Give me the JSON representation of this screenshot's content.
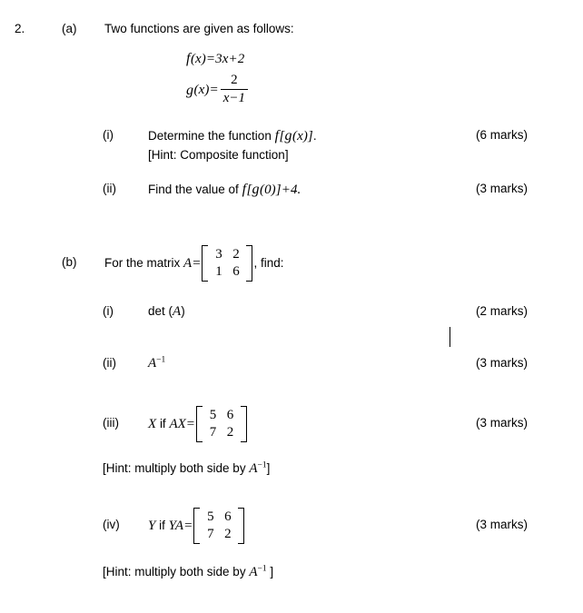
{
  "document": {
    "question_number": "2.",
    "background_color": "#ffffff",
    "text_color": "#000000"
  },
  "part_a": {
    "label": "(a)",
    "stem": "Two functions are given as follows:",
    "equations": [
      {
        "name": "f-definition",
        "fn": "f",
        "arg": "(x)",
        "eq": "=",
        "rhs_coeff": "3",
        "rhs_var": "x",
        "rhs_op": "+",
        "rhs_const": "2",
        "plain": "f(x) = 3x + 2"
      },
      {
        "name": "g-definition",
        "fn": "g",
        "arg": "(x)",
        "eq": "=",
        "numerator": "2",
        "den_var": "x",
        "den_op": "−",
        "den_const": "1",
        "plain": "g(x) = 2 / (x - 1)"
      }
    ],
    "items": [
      {
        "label": "(i)",
        "text_before": "Determine the function",
        "expr_fn": "f",
        "expr_body": "[",
        "expr_g": "g",
        "expr_tail": "(x)]",
        "text_after": ".",
        "plain_expr": "f[g(x)]",
        "hint": "[Hint: Composite function]",
        "marks": "(6 marks)"
      },
      {
        "label": "(ii)",
        "text_before": "Find the value of",
        "expr_fn": "f",
        "expr_body": "[",
        "expr_g": "g",
        "expr_tail": "(0)]",
        "expr_op": "+",
        "expr_const": "4.",
        "plain_expr": "f[g(0)] + 4.",
        "marks": "(3 marks)"
      }
    ]
  },
  "part_b": {
    "label": "(b)",
    "stem_before": "For the matrix",
    "stem_var": "A",
    "stem_eq": "=",
    "matrix": {
      "name": "matrix-A",
      "rows": [
        [
          "3",
          "2"
        ],
        [
          "1",
          "6"
        ]
      ]
    },
    "stem_after": ", find:",
    "items": [
      {
        "label": "(i)",
        "text": "det (",
        "var": "A",
        "text_close": ")",
        "plain": "det (A)",
        "marks": "(2 marks)"
      },
      {
        "label": "(ii)",
        "var": "A",
        "exponent": "−1",
        "plain": "A⁻¹",
        "marks": "(3 marks)"
      },
      {
        "label": "(iii)",
        "unknown": "X",
        "conn": "if",
        "lhs": "AX",
        "eq": "=",
        "matrix": {
          "name": "matrix-rhs-x",
          "rows": [
            [
              "5",
              "6"
            ],
            [
              "7",
              "2"
            ]
          ]
        },
        "plain": "X if AX = [[5,6],[7,2]]",
        "marks": "(3 marks)",
        "hint_before": "[Hint: multiply both side by",
        "hint_var": "A",
        "hint_exp": "−1",
        "hint_after": "]",
        "hint_plain": "[Hint: multiply both side by A⁻¹]"
      },
      {
        "label": "(iv)",
        "unknown": "Y",
        "conn": "if",
        "lhs": "YA",
        "eq": "=",
        "matrix": {
          "name": "matrix-rhs-y",
          "rows": [
            [
              "5",
              "6"
            ],
            [
              "7",
              "2"
            ]
          ]
        },
        "plain": "Y if YA = [[5,6],[7,2]]",
        "marks": "(3 marks)",
        "hint_before": "[Hint: multiply both side by",
        "hint_var": "A",
        "hint_exp": "−1",
        "hint_after": " ]",
        "hint_plain": "[Hint: multiply both side by A⁻¹ ]"
      }
    ]
  },
  "caret": {
    "name": "text-caret",
    "visible": true
  }
}
